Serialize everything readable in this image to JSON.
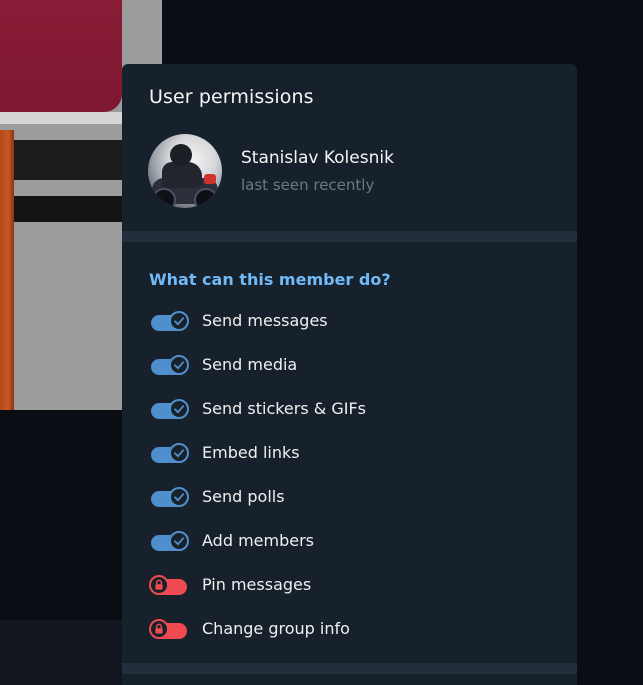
{
  "dialog": {
    "title": "User permissions"
  },
  "user": {
    "name": "Stanislav Kolesnik",
    "status": "last seen recently"
  },
  "permissions": {
    "section_title": "What can this member do?",
    "items": [
      {
        "label": "Send messages",
        "enabled": true
      },
      {
        "label": "Send media",
        "enabled": true
      },
      {
        "label": "Send stickers & GIFs",
        "enabled": true
      },
      {
        "label": "Embed links",
        "enabled": true
      },
      {
        "label": "Send polls",
        "enabled": true
      },
      {
        "label": "Add members",
        "enabled": true
      },
      {
        "label": "Pin messages",
        "enabled": false
      },
      {
        "label": "Change group info",
        "enabled": false
      }
    ]
  },
  "icons": {
    "enabled": "checkmark-icon",
    "disabled": "lock-icon"
  },
  "colors": {
    "dialog_bg": "#17212b",
    "accent": "#4f8fcd",
    "section_title": "#71baf8",
    "locked": "#ee4a4f",
    "status_text": "#6d7883"
  }
}
